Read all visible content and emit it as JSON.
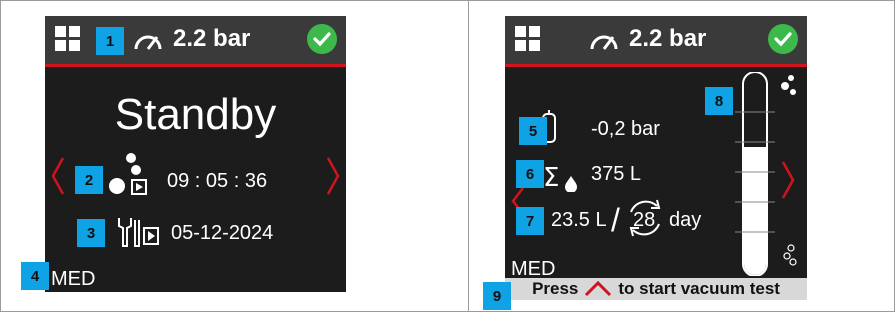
{
  "left_screen": {
    "header": {
      "pressure": "2.2 bar",
      "icons": [
        "grid-menu-icon",
        "pressure-gauge-icon",
        "status-ok-icon"
      ]
    },
    "status": "Standby",
    "timer": {
      "value": "09 : 05 : 36",
      "icon": "bubbles-play-icon"
    },
    "service": {
      "date": "05-12-2024",
      "icon": "tools-play-icon"
    },
    "mode": "MED",
    "badges": [
      "1",
      "2",
      "3",
      "4"
    ],
    "nav": [
      "chevron-left-icon",
      "chevron-right-icon"
    ]
  },
  "right_screen": {
    "header": {
      "pressure": "2.2 bar",
      "icons": [
        "grid-menu-icon",
        "pressure-gauge-icon",
        "status-ok-icon"
      ]
    },
    "vacuum": {
      "value": "-0,2 bar",
      "icon": "vacuum-cylinder-icon"
    },
    "total": {
      "value": "375 L",
      "icon": "sum-drop-icon"
    },
    "rate": {
      "volume": "23.5 L",
      "separator": "/",
      "days": "28",
      "unit": "day",
      "icon": "cycle-arrows-icon"
    },
    "mode": "MED",
    "footer": {
      "press": "Press",
      "action": "to start vacuum test",
      "icon": "up-arrow-icon"
    },
    "tube_level": 0.65,
    "badges": [
      "5",
      "6",
      "7",
      "8",
      "9"
    ],
    "colors": {
      "accent_red": "#d0141e",
      "ok_green": "#3cb94a",
      "badge_blue": "#0fa3e6",
      "screen_bg": "#1c1c1c"
    }
  }
}
